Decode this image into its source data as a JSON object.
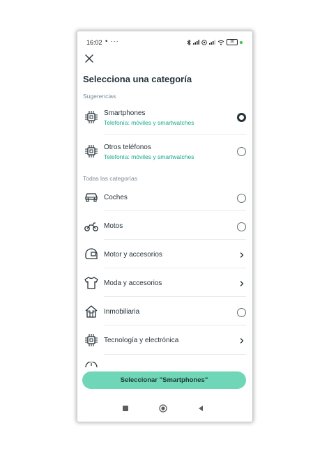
{
  "status_bar": {
    "time": "16:02",
    "extra": "• ···",
    "battery": "38",
    "icons": [
      "bluetooth-icon",
      "signal-icon",
      "hotspot-icon",
      "signal-icon",
      "wifi-icon",
      "battery-icon"
    ]
  },
  "page_title": "Selecciona una categoría",
  "sections": {
    "suggestions": "Sugerencias",
    "all": "Todas las categorías"
  },
  "suggestions": [
    {
      "title": "Smartphones",
      "subtitle": "Telefonía: móviles y smartwatches",
      "control": "radio",
      "selected": true,
      "icon": "chip-icon"
    },
    {
      "title": "Otros teléfonos",
      "subtitle": "Telefonía: móviles y smartwatches",
      "control": "radio",
      "selected": false,
      "icon": "chip-icon"
    }
  ],
  "categories": [
    {
      "title": "Coches",
      "control": "radio",
      "selected": false,
      "icon": "car-icon"
    },
    {
      "title": "Motos",
      "control": "radio",
      "selected": false,
      "icon": "motorcycle-icon"
    },
    {
      "title": "Motor y accesorios",
      "control": "chevron",
      "icon": "helmet-icon"
    },
    {
      "title": "Moda y accesorios",
      "control": "chevron",
      "icon": "tshirt-icon"
    },
    {
      "title": "Inmobiliaria",
      "control": "radio",
      "selected": false,
      "icon": "house-icon"
    },
    {
      "title": "Tecnología y electrónica",
      "control": "chevron",
      "icon": "chip-icon"
    }
  ],
  "cta_label": "Seleccionar \"Smartphones\"",
  "colors": {
    "accent": "#6fd6b7",
    "subtitle": "#13a98a",
    "text": "#253238",
    "muted": "#7b8a92"
  }
}
